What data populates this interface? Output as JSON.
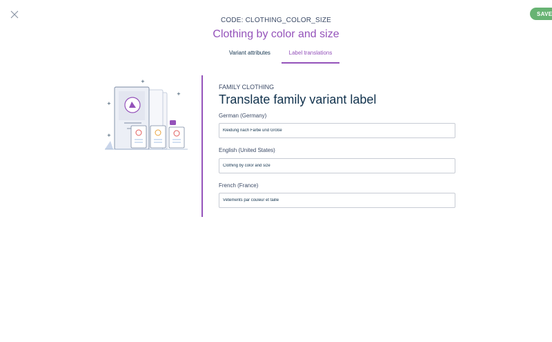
{
  "header": {
    "save_label": "SAVE",
    "code_line": "CODE: CLOTHING_COLOR_SIZE",
    "title": "Clothing by color and size"
  },
  "tabs": [
    {
      "label": "Variant attributes",
      "active": false
    },
    {
      "label": "Label translations",
      "active": true
    }
  ],
  "content": {
    "family_line": "FAMILY CLOTHING",
    "section_title": "Translate family variant label",
    "fields": [
      {
        "label": "German (Germany)",
        "value": "Kleidung nach Farbe und Größe"
      },
      {
        "label": "English (United States)",
        "value": "Clothing by color and size"
      },
      {
        "label": "French (France)",
        "value": "Vêtements par couleur et taille"
      }
    ]
  },
  "colors": {
    "accent": "#9452ba",
    "save_green": "#67b373",
    "text": "#11324d",
    "input_border": "#c7cbd4"
  },
  "icons": {
    "close": "close-icon",
    "illustration": "product-cards-illustration"
  }
}
